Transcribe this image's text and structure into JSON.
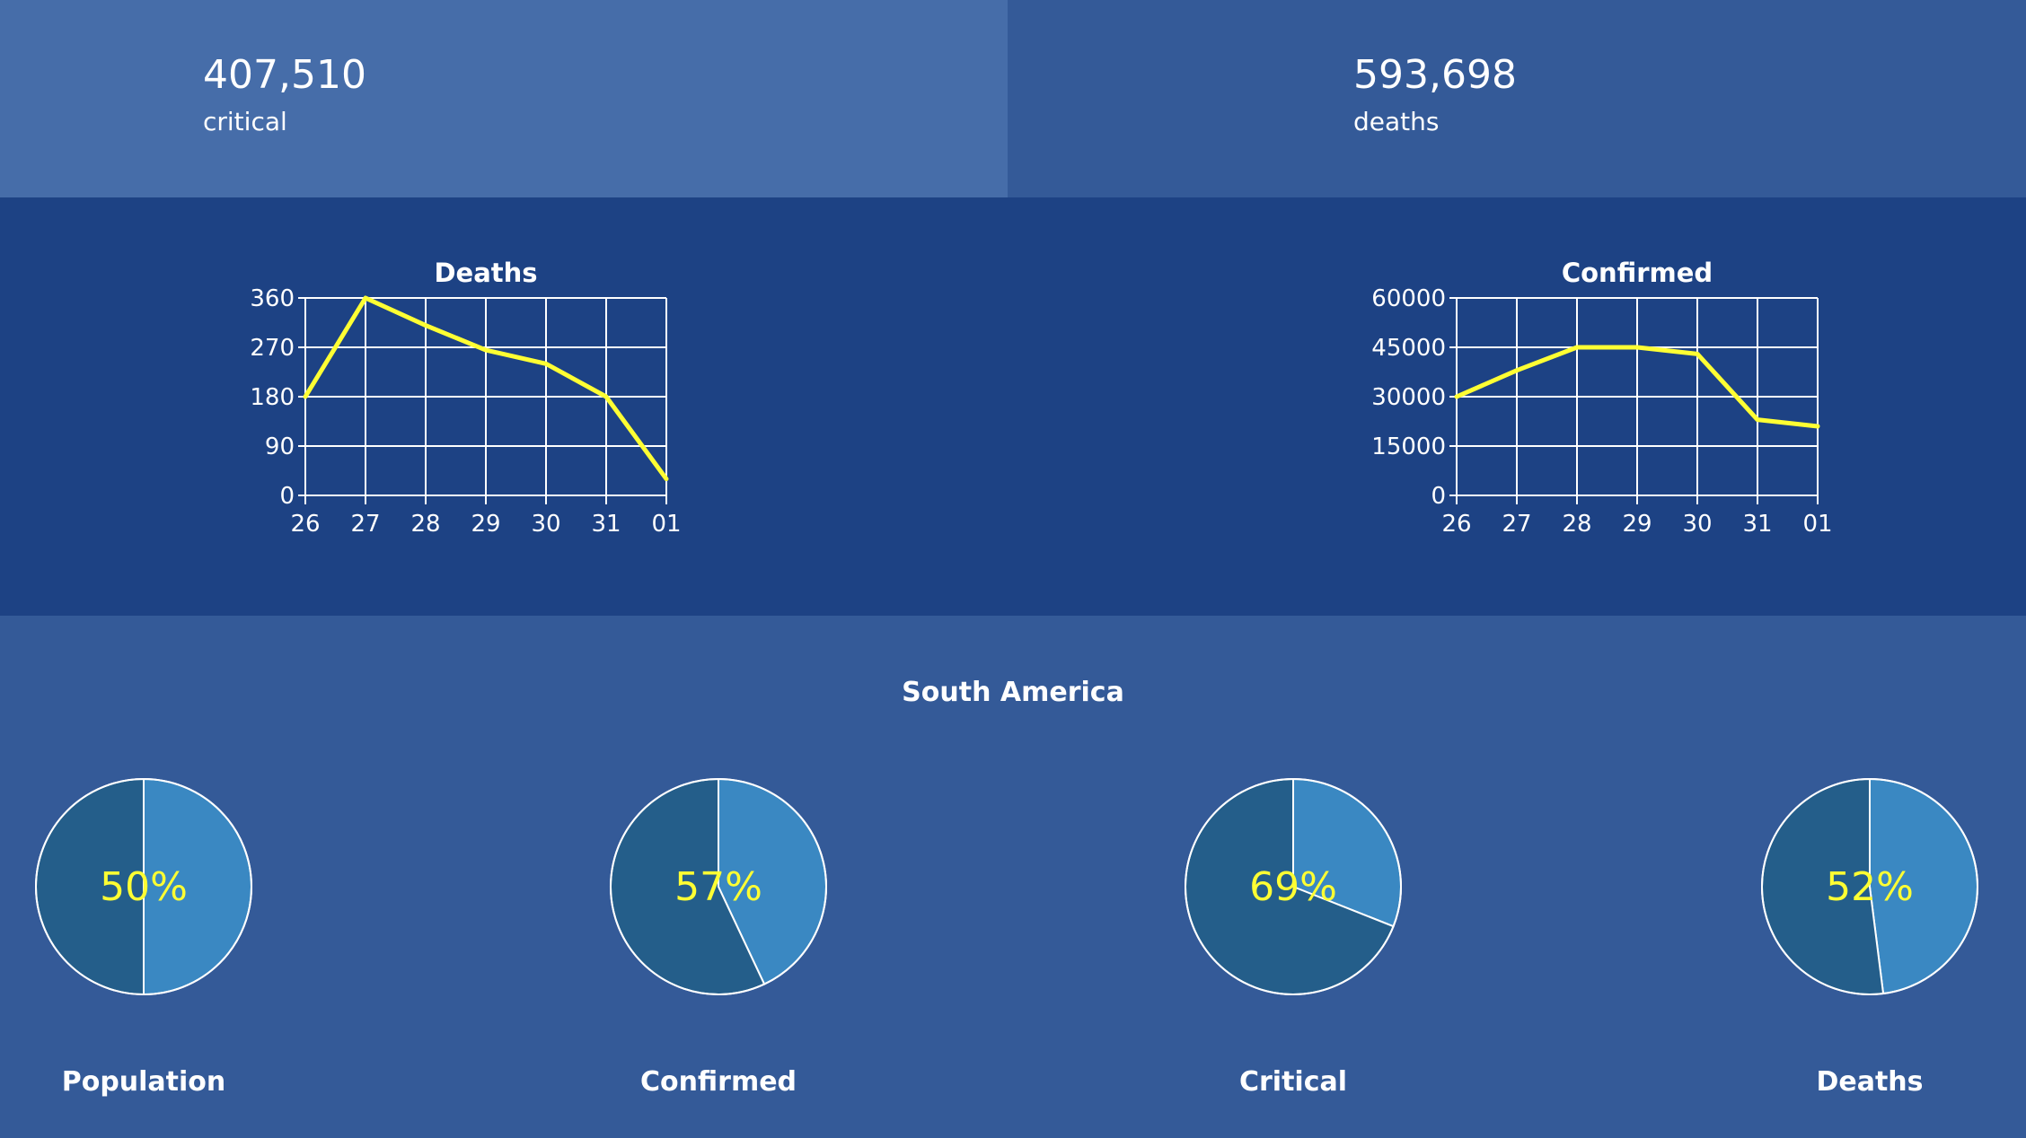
{
  "stats": [
    {
      "value": "407,510",
      "label": "critical"
    },
    {
      "value": "593,698",
      "label": "deaths"
    }
  ],
  "colors": {
    "line": "#ffff33",
    "pie_main": "#245e8a",
    "pie_secondary": "#3a88c2",
    "pie_stroke": "#ffffff",
    "grid": "#ffffff",
    "text_highlight": "#ffff33"
  },
  "region": {
    "title": "South America"
  },
  "chart_data": [
    {
      "type": "line",
      "title": "Deaths",
      "xlabel": "",
      "ylabel": "",
      "categories": [
        "26",
        "27",
        "28",
        "29",
        "30",
        "31",
        "01"
      ],
      "series": [
        {
          "values": [
            180,
            360,
            310,
            265,
            240,
            180,
            30
          ]
        }
      ],
      "ylim": [
        0,
        360
      ],
      "yticks": [
        0,
        90,
        180,
        270,
        360
      ],
      "grid": true
    },
    {
      "type": "line",
      "title": "Confirmed",
      "xlabel": "",
      "ylabel": "",
      "categories": [
        "26",
        "27",
        "28",
        "29",
        "30",
        "31",
        "01"
      ],
      "series": [
        {
          "values": [
            30000,
            38000,
            45000,
            45000,
            43000,
            23000,
            21000
          ]
        }
      ],
      "ylim": [
        0,
        60000
      ],
      "yticks": [
        0,
        15000,
        30000,
        45000,
        60000
      ],
      "grid": true
    },
    {
      "type": "pie",
      "title": "Population",
      "label": "50%",
      "values": [
        50,
        50
      ]
    },
    {
      "type": "pie",
      "title": "Confirmed",
      "label": "57%",
      "values": [
        57,
        43
      ]
    },
    {
      "type": "pie",
      "title": "Critical",
      "label": "69%",
      "values": [
        69,
        31
      ]
    },
    {
      "type": "pie",
      "title": "Deaths",
      "label": "52%",
      "values": [
        52,
        48
      ]
    }
  ]
}
